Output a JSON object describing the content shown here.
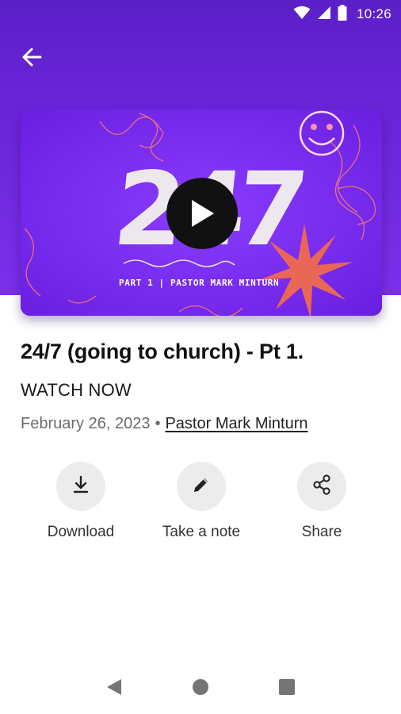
{
  "status_bar": {
    "time": "10:26"
  },
  "video": {
    "title": "24/7 (going to church) - Pt 1.",
    "subtitle": "WATCH NOW",
    "date": "February 26, 2023",
    "separator": "•",
    "author": "Pastor Mark Minturn",
    "thumbnail": {
      "big_text": "24/7",
      "caption": "PART 1 | PASTOR MARK MINTURN"
    }
  },
  "actions": [
    {
      "label": "Download",
      "icon": "download-icon"
    },
    {
      "label": "Take a note",
      "icon": "pencil-icon"
    },
    {
      "label": "Share",
      "icon": "share-icon"
    }
  ],
  "colors": {
    "header": "#6a24d8",
    "thumbnail_bg": "#7a2bf0",
    "burst": "#f06a4e",
    "action_circle": "#ececec"
  }
}
